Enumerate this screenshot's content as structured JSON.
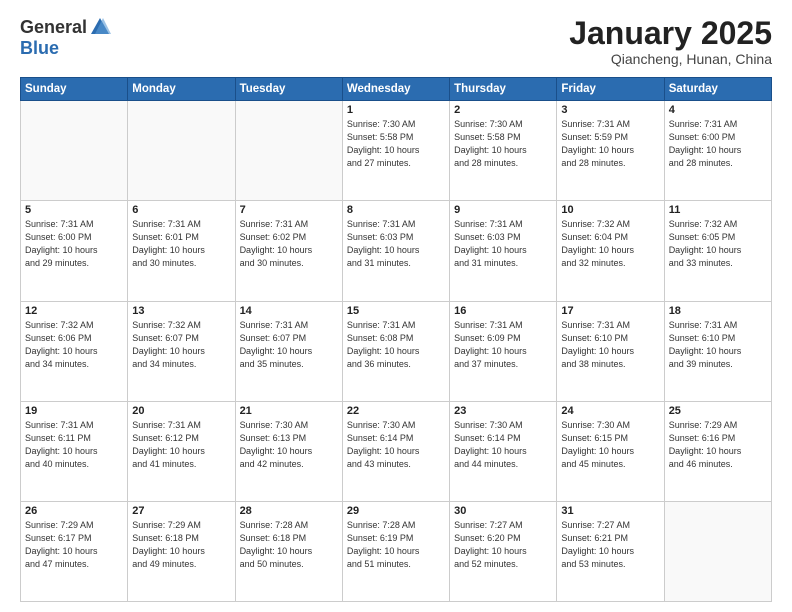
{
  "header": {
    "logo_general": "General",
    "logo_blue": "Blue",
    "month_title": "January 2025",
    "location": "Qiancheng, Hunan, China"
  },
  "days_of_week": [
    "Sunday",
    "Monday",
    "Tuesday",
    "Wednesday",
    "Thursday",
    "Friday",
    "Saturday"
  ],
  "weeks": [
    [
      {
        "day": "",
        "info": ""
      },
      {
        "day": "",
        "info": ""
      },
      {
        "day": "",
        "info": ""
      },
      {
        "day": "1",
        "info": "Sunrise: 7:30 AM\nSunset: 5:58 PM\nDaylight: 10 hours\nand 27 minutes."
      },
      {
        "day": "2",
        "info": "Sunrise: 7:30 AM\nSunset: 5:58 PM\nDaylight: 10 hours\nand 28 minutes."
      },
      {
        "day": "3",
        "info": "Sunrise: 7:31 AM\nSunset: 5:59 PM\nDaylight: 10 hours\nand 28 minutes."
      },
      {
        "day": "4",
        "info": "Sunrise: 7:31 AM\nSunset: 6:00 PM\nDaylight: 10 hours\nand 28 minutes."
      }
    ],
    [
      {
        "day": "5",
        "info": "Sunrise: 7:31 AM\nSunset: 6:00 PM\nDaylight: 10 hours\nand 29 minutes."
      },
      {
        "day": "6",
        "info": "Sunrise: 7:31 AM\nSunset: 6:01 PM\nDaylight: 10 hours\nand 30 minutes."
      },
      {
        "day": "7",
        "info": "Sunrise: 7:31 AM\nSunset: 6:02 PM\nDaylight: 10 hours\nand 30 minutes."
      },
      {
        "day": "8",
        "info": "Sunrise: 7:31 AM\nSunset: 6:03 PM\nDaylight: 10 hours\nand 31 minutes."
      },
      {
        "day": "9",
        "info": "Sunrise: 7:31 AM\nSunset: 6:03 PM\nDaylight: 10 hours\nand 31 minutes."
      },
      {
        "day": "10",
        "info": "Sunrise: 7:32 AM\nSunset: 6:04 PM\nDaylight: 10 hours\nand 32 minutes."
      },
      {
        "day": "11",
        "info": "Sunrise: 7:32 AM\nSunset: 6:05 PM\nDaylight: 10 hours\nand 33 minutes."
      }
    ],
    [
      {
        "day": "12",
        "info": "Sunrise: 7:32 AM\nSunset: 6:06 PM\nDaylight: 10 hours\nand 34 minutes."
      },
      {
        "day": "13",
        "info": "Sunrise: 7:32 AM\nSunset: 6:07 PM\nDaylight: 10 hours\nand 34 minutes."
      },
      {
        "day": "14",
        "info": "Sunrise: 7:31 AM\nSunset: 6:07 PM\nDaylight: 10 hours\nand 35 minutes."
      },
      {
        "day": "15",
        "info": "Sunrise: 7:31 AM\nSunset: 6:08 PM\nDaylight: 10 hours\nand 36 minutes."
      },
      {
        "day": "16",
        "info": "Sunrise: 7:31 AM\nSunset: 6:09 PM\nDaylight: 10 hours\nand 37 minutes."
      },
      {
        "day": "17",
        "info": "Sunrise: 7:31 AM\nSunset: 6:10 PM\nDaylight: 10 hours\nand 38 minutes."
      },
      {
        "day": "18",
        "info": "Sunrise: 7:31 AM\nSunset: 6:10 PM\nDaylight: 10 hours\nand 39 minutes."
      }
    ],
    [
      {
        "day": "19",
        "info": "Sunrise: 7:31 AM\nSunset: 6:11 PM\nDaylight: 10 hours\nand 40 minutes."
      },
      {
        "day": "20",
        "info": "Sunrise: 7:31 AM\nSunset: 6:12 PM\nDaylight: 10 hours\nand 41 minutes."
      },
      {
        "day": "21",
        "info": "Sunrise: 7:30 AM\nSunset: 6:13 PM\nDaylight: 10 hours\nand 42 minutes."
      },
      {
        "day": "22",
        "info": "Sunrise: 7:30 AM\nSunset: 6:14 PM\nDaylight: 10 hours\nand 43 minutes."
      },
      {
        "day": "23",
        "info": "Sunrise: 7:30 AM\nSunset: 6:14 PM\nDaylight: 10 hours\nand 44 minutes."
      },
      {
        "day": "24",
        "info": "Sunrise: 7:30 AM\nSunset: 6:15 PM\nDaylight: 10 hours\nand 45 minutes."
      },
      {
        "day": "25",
        "info": "Sunrise: 7:29 AM\nSunset: 6:16 PM\nDaylight: 10 hours\nand 46 minutes."
      }
    ],
    [
      {
        "day": "26",
        "info": "Sunrise: 7:29 AM\nSunset: 6:17 PM\nDaylight: 10 hours\nand 47 minutes."
      },
      {
        "day": "27",
        "info": "Sunrise: 7:29 AM\nSunset: 6:18 PM\nDaylight: 10 hours\nand 49 minutes."
      },
      {
        "day": "28",
        "info": "Sunrise: 7:28 AM\nSunset: 6:18 PM\nDaylight: 10 hours\nand 50 minutes."
      },
      {
        "day": "29",
        "info": "Sunrise: 7:28 AM\nSunset: 6:19 PM\nDaylight: 10 hours\nand 51 minutes."
      },
      {
        "day": "30",
        "info": "Sunrise: 7:27 AM\nSunset: 6:20 PM\nDaylight: 10 hours\nand 52 minutes."
      },
      {
        "day": "31",
        "info": "Sunrise: 7:27 AM\nSunset: 6:21 PM\nDaylight: 10 hours\nand 53 minutes."
      },
      {
        "day": "",
        "info": ""
      }
    ]
  ]
}
